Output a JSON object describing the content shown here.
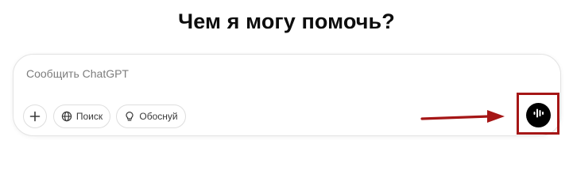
{
  "headline": "Чем я могу помочь?",
  "composer": {
    "placeholder": "Сообщить ChatGPT",
    "value": ""
  },
  "tools": {
    "add_icon": "plus-icon",
    "search": {
      "icon": "globe-icon",
      "label": "Поиск"
    },
    "reason": {
      "icon": "lightbulb-icon",
      "label": "Обоснуй"
    }
  },
  "voice": {
    "icon": "voice-waveform-icon"
  },
  "annotation": {
    "color": "#a51616"
  }
}
